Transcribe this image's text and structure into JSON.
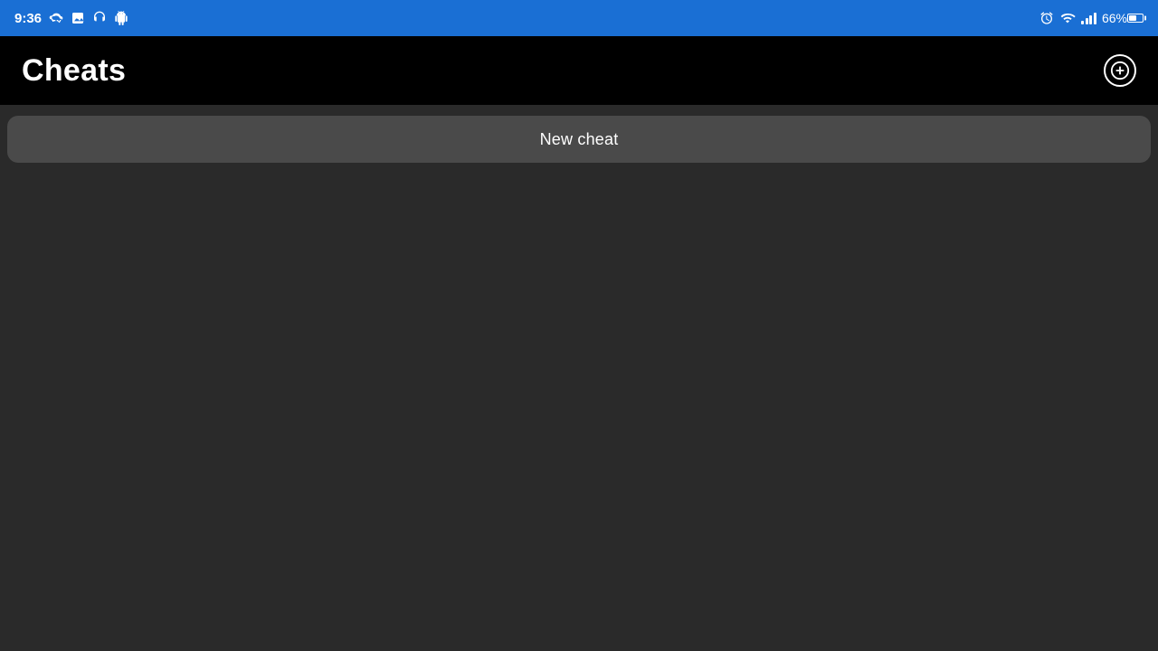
{
  "statusBar": {
    "time": "9:36",
    "batteryPercent": "66%",
    "icons": {
      "alarm": "⏰",
      "wifi": "wifi",
      "signal": "signal",
      "battery": "battery",
      "sync": "sync",
      "gallery": "🖼",
      "headset": "🎧",
      "android": "android"
    }
  },
  "titleBar": {
    "title": "Cheats",
    "addButtonLabel": "+"
  },
  "mainContent": {
    "newCheatButton": "New cheat"
  }
}
